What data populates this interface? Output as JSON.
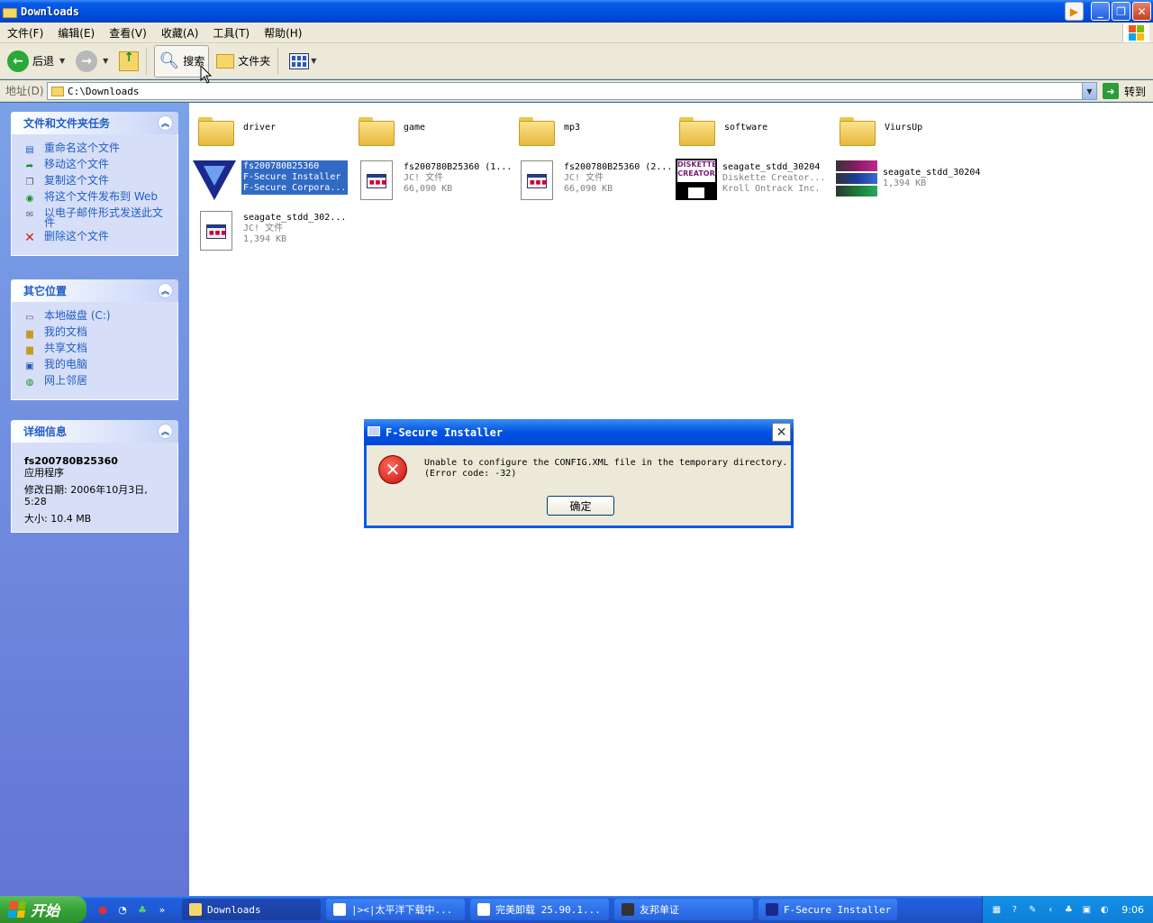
{
  "window": {
    "title": "Downloads",
    "buttons": {
      "minimize": "_",
      "maximize": "❐",
      "close": "✕"
    }
  },
  "menu": [
    "文件(F)",
    "编辑(E)",
    "查看(V)",
    "收藏(A)",
    "工具(T)",
    "帮助(H)"
  ],
  "toolbar": {
    "back": "后退",
    "search": "搜索",
    "folders": "文件夹"
  },
  "address": {
    "label": "地址(D)",
    "value": "C:\\Downloads",
    "go": "转到"
  },
  "tasks_panel": {
    "title": "文件和文件夹任务",
    "links": [
      "重命名这个文件",
      "移动这个文件",
      "复制这个文件",
      "将这个文件发布到 Web",
      "以电子邮件形式发送此文件",
      "删除这个文件"
    ]
  },
  "places_panel": {
    "title": "其它位置",
    "links": [
      "本地磁盘 (C:)",
      "我的文档",
      "共享文档",
      "我的电脑",
      "网上邻居"
    ]
  },
  "details_panel": {
    "title": "详细信息",
    "name": "fs200780B25360",
    "type": "应用程序",
    "modified": "修改日期: 2006年10月3日, 5:28",
    "size": "大小: 10.4 MB"
  },
  "files": [
    {
      "name": "driver"
    },
    {
      "name": "game"
    },
    {
      "name": "mp3"
    },
    {
      "name": "software"
    },
    {
      "name": "ViursUp"
    },
    {
      "name": "fs200780B25360",
      "line2": "F-Secure Installer",
      "line3": "F-Secure Corpora..."
    },
    {
      "name": "fs200780B25360 (1...",
      "line2": "JC! 文件",
      "line3": "66,090 KB"
    },
    {
      "name": "fs200780B25360 (2...",
      "line2": "JC! 文件",
      "line3": "66,090 KB"
    },
    {
      "name": "seagate_stdd_30204",
      "line2": "Diskette Creator...",
      "line3": "Kroll Ontrack Inc."
    },
    {
      "name": "seagate_stdd_30204",
      "line2": "1,394 KB"
    },
    {
      "name": "seagate_stdd_302...",
      "line2": "JC! 文件",
      "line3": "1,394 KB"
    }
  ],
  "dialog": {
    "title": "F-Secure Installer",
    "message": "Unable to configure the CONFIG.XML file in the temporary directory.\n(Error code: -32)",
    "ok": "确定"
  },
  "taskbar": {
    "start": "开始",
    "tasks": [
      "Downloads",
      "|><|太平洋下载中...",
      "完美卸载 25.90.1...",
      "友邦单证",
      "F-Secure Installer"
    ],
    "clock": "9:06"
  }
}
